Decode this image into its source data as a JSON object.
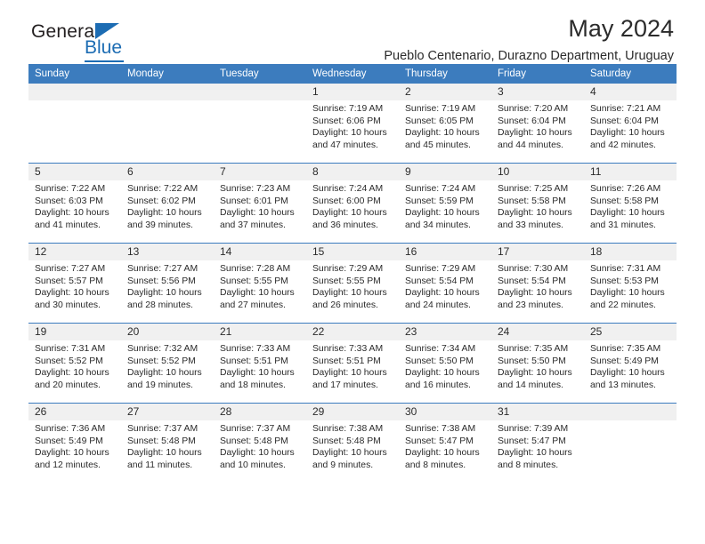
{
  "brand": {
    "name_top": "General",
    "name_bottom": "Blue",
    "accent_color": "#1c6cb3",
    "triangle_icon": "triangle-icon"
  },
  "header": {
    "title": "May 2024",
    "subtitle": "Pueblo Centenario, Durazno Department, Uruguay"
  },
  "calendar": {
    "header_bg": "#3c7cbe",
    "daynum_bg": "#f0f0f0",
    "weekdays": [
      "Sunday",
      "Monday",
      "Tuesday",
      "Wednesday",
      "Thursday",
      "Friday",
      "Saturday"
    ],
    "weeks": [
      [
        {
          "day": "",
          "empty": true
        },
        {
          "day": "",
          "empty": true
        },
        {
          "day": "",
          "empty": true
        },
        {
          "day": "1",
          "sunrise": "Sunrise: 7:19 AM",
          "sunset": "Sunset: 6:06 PM",
          "daylight_line1": "Daylight: 10 hours",
          "daylight_line2": "and 47 minutes."
        },
        {
          "day": "2",
          "sunrise": "Sunrise: 7:19 AM",
          "sunset": "Sunset: 6:05 PM",
          "daylight_line1": "Daylight: 10 hours",
          "daylight_line2": "and 45 minutes."
        },
        {
          "day": "3",
          "sunrise": "Sunrise: 7:20 AM",
          "sunset": "Sunset: 6:04 PM",
          "daylight_line1": "Daylight: 10 hours",
          "daylight_line2": "and 44 minutes."
        },
        {
          "day": "4",
          "sunrise": "Sunrise: 7:21 AM",
          "sunset": "Sunset: 6:04 PM",
          "daylight_line1": "Daylight: 10 hours",
          "daylight_line2": "and 42 minutes."
        }
      ],
      [
        {
          "day": "5",
          "sunrise": "Sunrise: 7:22 AM",
          "sunset": "Sunset: 6:03 PM",
          "daylight_line1": "Daylight: 10 hours",
          "daylight_line2": "and 41 minutes."
        },
        {
          "day": "6",
          "sunrise": "Sunrise: 7:22 AM",
          "sunset": "Sunset: 6:02 PM",
          "daylight_line1": "Daylight: 10 hours",
          "daylight_line2": "and 39 minutes."
        },
        {
          "day": "7",
          "sunrise": "Sunrise: 7:23 AM",
          "sunset": "Sunset: 6:01 PM",
          "daylight_line1": "Daylight: 10 hours",
          "daylight_line2": "and 37 minutes."
        },
        {
          "day": "8",
          "sunrise": "Sunrise: 7:24 AM",
          "sunset": "Sunset: 6:00 PM",
          "daylight_line1": "Daylight: 10 hours",
          "daylight_line2": "and 36 minutes."
        },
        {
          "day": "9",
          "sunrise": "Sunrise: 7:24 AM",
          "sunset": "Sunset: 5:59 PM",
          "daylight_line1": "Daylight: 10 hours",
          "daylight_line2": "and 34 minutes."
        },
        {
          "day": "10",
          "sunrise": "Sunrise: 7:25 AM",
          "sunset": "Sunset: 5:58 PM",
          "daylight_line1": "Daylight: 10 hours",
          "daylight_line2": "and 33 minutes."
        },
        {
          "day": "11",
          "sunrise": "Sunrise: 7:26 AM",
          "sunset": "Sunset: 5:58 PM",
          "daylight_line1": "Daylight: 10 hours",
          "daylight_line2": "and 31 minutes."
        }
      ],
      [
        {
          "day": "12",
          "sunrise": "Sunrise: 7:27 AM",
          "sunset": "Sunset: 5:57 PM",
          "daylight_line1": "Daylight: 10 hours",
          "daylight_line2": "and 30 minutes."
        },
        {
          "day": "13",
          "sunrise": "Sunrise: 7:27 AM",
          "sunset": "Sunset: 5:56 PM",
          "daylight_line1": "Daylight: 10 hours",
          "daylight_line2": "and 28 minutes."
        },
        {
          "day": "14",
          "sunrise": "Sunrise: 7:28 AM",
          "sunset": "Sunset: 5:55 PM",
          "daylight_line1": "Daylight: 10 hours",
          "daylight_line2": "and 27 minutes."
        },
        {
          "day": "15",
          "sunrise": "Sunrise: 7:29 AM",
          "sunset": "Sunset: 5:55 PM",
          "daylight_line1": "Daylight: 10 hours",
          "daylight_line2": "and 26 minutes."
        },
        {
          "day": "16",
          "sunrise": "Sunrise: 7:29 AM",
          "sunset": "Sunset: 5:54 PM",
          "daylight_line1": "Daylight: 10 hours",
          "daylight_line2": "and 24 minutes."
        },
        {
          "day": "17",
          "sunrise": "Sunrise: 7:30 AM",
          "sunset": "Sunset: 5:54 PM",
          "daylight_line1": "Daylight: 10 hours",
          "daylight_line2": "and 23 minutes."
        },
        {
          "day": "18",
          "sunrise": "Sunrise: 7:31 AM",
          "sunset": "Sunset: 5:53 PM",
          "daylight_line1": "Daylight: 10 hours",
          "daylight_line2": "and 22 minutes."
        }
      ],
      [
        {
          "day": "19",
          "sunrise": "Sunrise: 7:31 AM",
          "sunset": "Sunset: 5:52 PM",
          "daylight_line1": "Daylight: 10 hours",
          "daylight_line2": "and 20 minutes."
        },
        {
          "day": "20",
          "sunrise": "Sunrise: 7:32 AM",
          "sunset": "Sunset: 5:52 PM",
          "daylight_line1": "Daylight: 10 hours",
          "daylight_line2": "and 19 minutes."
        },
        {
          "day": "21",
          "sunrise": "Sunrise: 7:33 AM",
          "sunset": "Sunset: 5:51 PM",
          "daylight_line1": "Daylight: 10 hours",
          "daylight_line2": "and 18 minutes."
        },
        {
          "day": "22",
          "sunrise": "Sunrise: 7:33 AM",
          "sunset": "Sunset: 5:51 PM",
          "daylight_line1": "Daylight: 10 hours",
          "daylight_line2": "and 17 minutes."
        },
        {
          "day": "23",
          "sunrise": "Sunrise: 7:34 AM",
          "sunset": "Sunset: 5:50 PM",
          "daylight_line1": "Daylight: 10 hours",
          "daylight_line2": "and 16 minutes."
        },
        {
          "day": "24",
          "sunrise": "Sunrise: 7:35 AM",
          "sunset": "Sunset: 5:50 PM",
          "daylight_line1": "Daylight: 10 hours",
          "daylight_line2": "and 14 minutes."
        },
        {
          "day": "25",
          "sunrise": "Sunrise: 7:35 AM",
          "sunset": "Sunset: 5:49 PM",
          "daylight_line1": "Daylight: 10 hours",
          "daylight_line2": "and 13 minutes."
        }
      ],
      [
        {
          "day": "26",
          "sunrise": "Sunrise: 7:36 AM",
          "sunset": "Sunset: 5:49 PM",
          "daylight_line1": "Daylight: 10 hours",
          "daylight_line2": "and 12 minutes."
        },
        {
          "day": "27",
          "sunrise": "Sunrise: 7:37 AM",
          "sunset": "Sunset: 5:48 PM",
          "daylight_line1": "Daylight: 10 hours",
          "daylight_line2": "and 11 minutes."
        },
        {
          "day": "28",
          "sunrise": "Sunrise: 7:37 AM",
          "sunset": "Sunset: 5:48 PM",
          "daylight_line1": "Daylight: 10 hours",
          "daylight_line2": "and 10 minutes."
        },
        {
          "day": "29",
          "sunrise": "Sunrise: 7:38 AM",
          "sunset": "Sunset: 5:48 PM",
          "daylight_line1": "Daylight: 10 hours",
          "daylight_line2": "and 9 minutes."
        },
        {
          "day": "30",
          "sunrise": "Sunrise: 7:38 AM",
          "sunset": "Sunset: 5:47 PM",
          "daylight_line1": "Daylight: 10 hours",
          "daylight_line2": "and 8 minutes."
        },
        {
          "day": "31",
          "sunrise": "Sunrise: 7:39 AM",
          "sunset": "Sunset: 5:47 PM",
          "daylight_line1": "Daylight: 10 hours",
          "daylight_line2": "and 8 minutes."
        },
        {
          "day": "",
          "empty": true
        }
      ]
    ]
  }
}
